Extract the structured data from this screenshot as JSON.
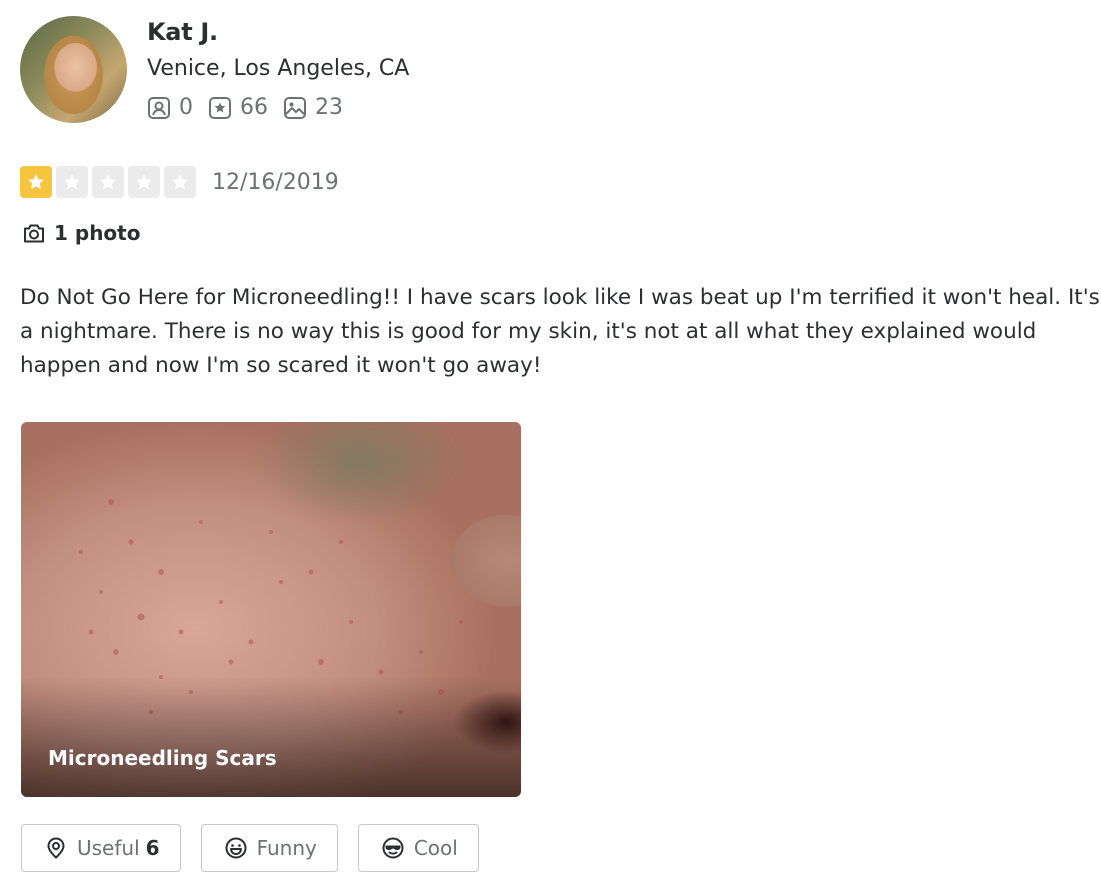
{
  "reviewer": {
    "name": "Kat J.",
    "location": "Venice, Los Angeles, CA",
    "stats": {
      "friends": "0",
      "reviews": "66",
      "photos": "23"
    }
  },
  "review": {
    "rating": 1,
    "rating_max": 5,
    "date": "12/16/2019",
    "photos_label": "1 photo",
    "text": "Do Not Go Here for Microneedling!! I have scars look like I was beat up I'm terrified it won't heal. It's a nightmare. There is no way this is good for my skin, it's not at all what they explained would happen and now I'm so scared it won't go away!",
    "photo_caption": "Microneedling Scars"
  },
  "actions": {
    "useful_label": "Useful",
    "useful_count": "6",
    "funny_label": "Funny",
    "cool_label": "Cool"
  },
  "colors": {
    "star_on": "#f4c53d",
    "star_off": "#ebebeb"
  },
  "icons": [
    "friends-icon",
    "review-star-icon",
    "photo-icon",
    "camera-icon",
    "star-icon",
    "useful-icon",
    "funny-icon",
    "cool-icon"
  ]
}
